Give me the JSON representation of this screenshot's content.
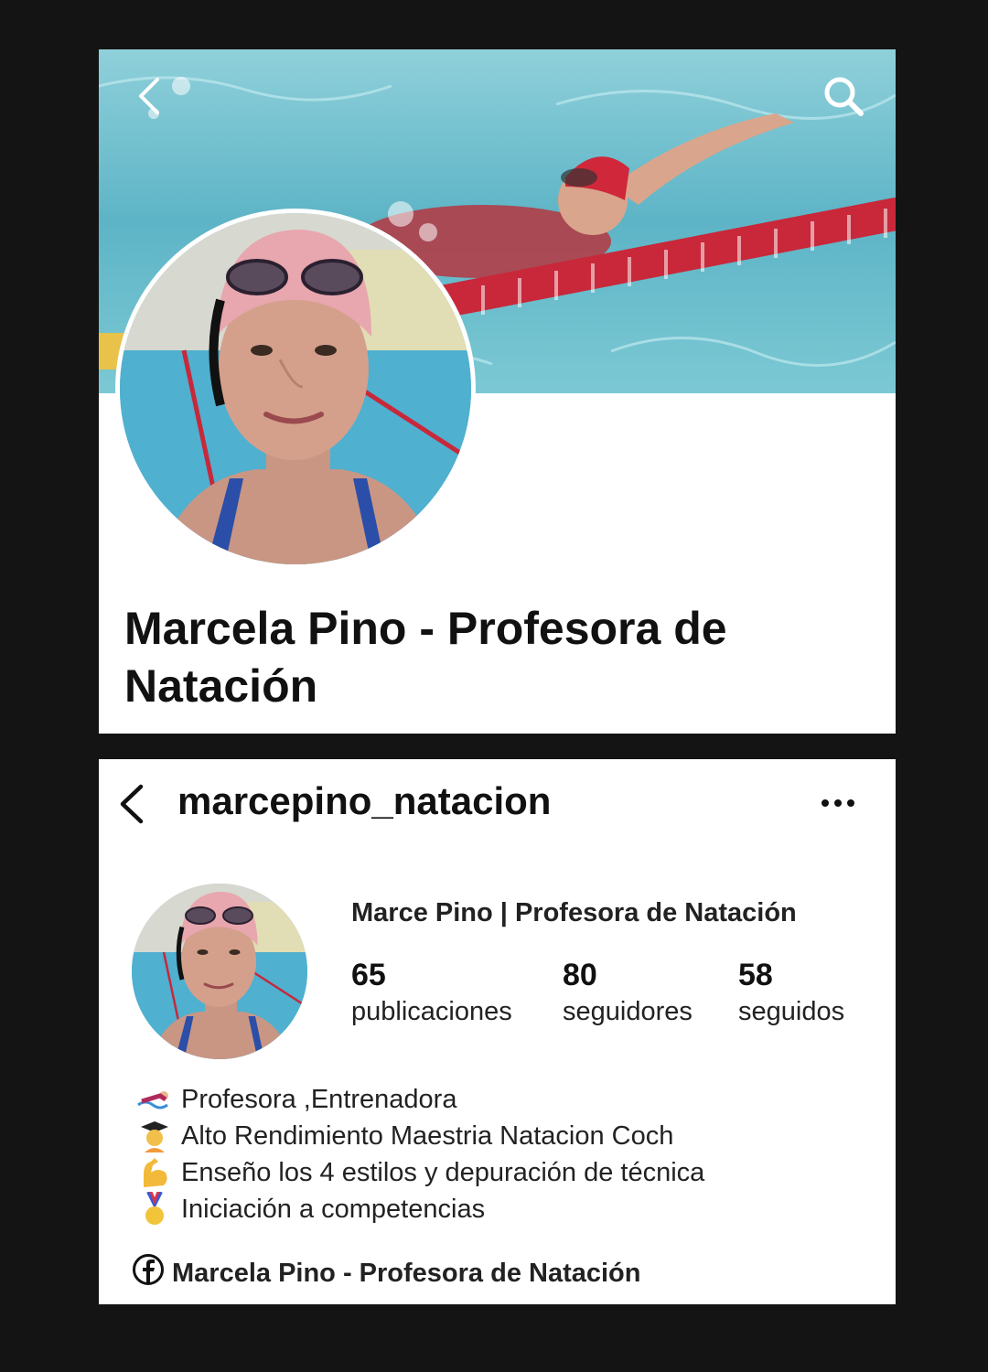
{
  "facebook_profile": {
    "cover_photo": "swimmer-in-pool-cover-photo",
    "back_icon": "chevron-left-icon",
    "search_icon": "search-icon",
    "profile_photo": "swimming-teacher-selfie-photo",
    "page_name": "Marcela Pino - Profesora de Natación"
  },
  "instagram_profile": {
    "back_icon": "chevron-left-icon",
    "username": "marcepino_natacion",
    "more_icon": "more-options-icon",
    "profile_photo": "swimming-teacher-selfie-photo",
    "display_name": "Marce Pino | Profesora de Natación",
    "stats": [
      {
        "value": "65",
        "label": "publicaciones"
      },
      {
        "value": "80",
        "label": "seguidores"
      },
      {
        "value": "58",
        "label": "seguidos"
      }
    ],
    "bio": [
      {
        "emoji": "swimmer-icon",
        "text": "Profesora ,Entrenadora"
      },
      {
        "emoji": "graduate-icon",
        "text": "Alto Rendimiento Maestria Natacion Coch"
      },
      {
        "emoji": "flexed-biceps-icon",
        "text": "Enseño los 4 estilos y depuración de técnica"
      },
      {
        "emoji": "medal-icon",
        "text": "Iniciación a competencias"
      }
    ],
    "link": {
      "icon": "facebook-icon",
      "text": "Marcela Pino - Profesora de Natación"
    }
  },
  "colors": {
    "background": "#141414",
    "panel": "#ffffff",
    "pool_water": "#6cc0cf",
    "lane_rope_red": "#c8283a",
    "text_primary": "#111111"
  }
}
